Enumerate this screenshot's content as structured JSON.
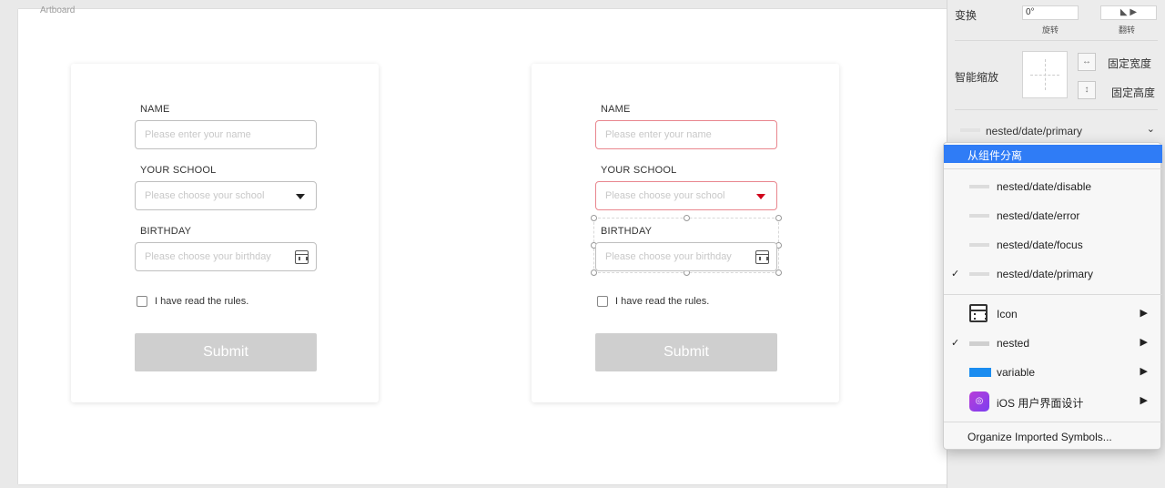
{
  "canvas": {
    "artboard_label": "Artboard"
  },
  "form_left": {
    "name_label": "NAME",
    "name_placeholder": "Please enter your name",
    "school_label": "YOUR SCHOOL",
    "school_placeholder": "Please choose your school",
    "birthday_label": "BIRTHDAY",
    "birthday_placeholder": "Please choose your birthday",
    "rules_label": "I have read the rules.",
    "submit_label": "Submit"
  },
  "form_right": {
    "name_label": "NAME",
    "name_placeholder": "Please enter your name",
    "school_label": "YOUR SCHOOL",
    "school_placeholder": "Please choose your school",
    "birthday_label": "BIRTHDAY",
    "birthday_placeholder": "Please choose your birthday",
    "rules_label": "I have read the rules.",
    "submit_label": "Submit"
  },
  "inspector": {
    "transform_label": "变换",
    "rotate_value": "0°",
    "rotate_label": "旋转",
    "flip_label": "翻转",
    "smart_resize_label": "智能缩放",
    "fix_width_label": "固定宽度",
    "fix_height_label": "固定高度",
    "symbol_value": "nested/date/primary"
  },
  "menu": {
    "detach_label": "从组件分离",
    "items": [
      {
        "label": "nested/date/disable",
        "checked": false
      },
      {
        "label": "nested/date/error",
        "checked": false
      },
      {
        "label": "nested/date/focus",
        "checked": false
      },
      {
        "label": "nested/date/primary",
        "checked": true
      }
    ],
    "groups": [
      {
        "label": "Icon",
        "icon": "calendar-icon",
        "checked": false
      },
      {
        "label": "nested",
        "icon": "nested-icon",
        "checked": true
      },
      {
        "label": "variable",
        "icon": "variable-icon",
        "checked": false
      },
      {
        "label": "iOS 用户界面设计",
        "icon": "ios-app-icon",
        "checked": false
      }
    ],
    "footer_label": "Organize Imported Symbols...",
    "check_mark": "✓",
    "submenu_arrow": "▶",
    "accent_color": "#2f7cf6"
  }
}
